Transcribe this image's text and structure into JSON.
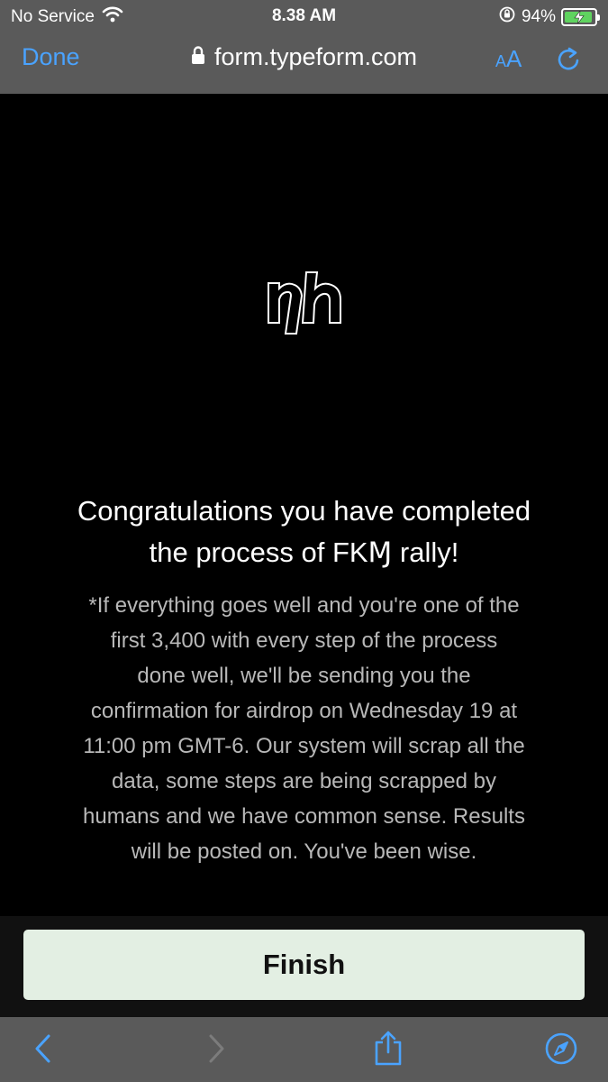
{
  "status_bar": {
    "carrier": "No Service",
    "time": "8.38 AM",
    "battery": "94%",
    "battery_level": 0.94
  },
  "browser": {
    "done_label": "Done",
    "url": "form.typeform.com",
    "text_size_label_small": "A",
    "text_size_label_large": "A"
  },
  "page": {
    "headline_line1": "Congratulations you have completed",
    "headline_line2": "the process of FKⱮ rally!",
    "body_lines": [
      "*If everything goes well and you're one of the",
      "first 3,400 with every step of the process",
      "done well, we'll be sending you the",
      "confirmation for airdrop on Wednesday 19 at",
      "11:00 pm GMT-6. Our system will scrap all the",
      "data, some steps are being scrapped by",
      "humans and we have common sense. Results",
      "will be posted on. You've been wise."
    ],
    "finish_label": "Finish"
  },
  "colors": {
    "accent": "#4aa3ff",
    "chrome": "#5a5a5a",
    "background": "#000000",
    "button_bg": "#e3efe3",
    "battery_fill": "#5fd35f"
  }
}
